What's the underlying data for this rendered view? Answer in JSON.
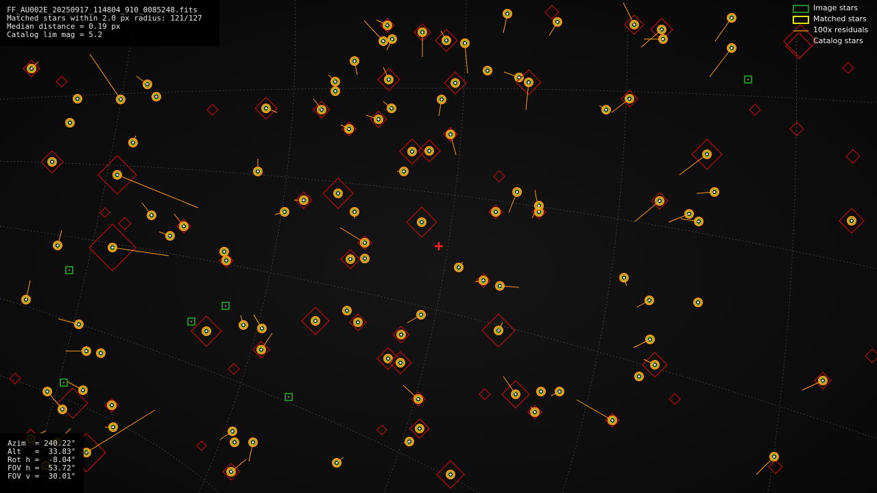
{
  "info_top": {
    "filename": "FF_AU002E_20250917_114804_910_0085248.fits",
    "matched_line": "Matched stars within 2.0 px radius: 121/127",
    "median_line": "Median distance = 0.19 px",
    "limmag_line": "Catalog lim mag = 5.2"
  },
  "info_bottom": {
    "azim": "Azim  = 240.22°",
    "alt": "Alt   =  33.83°",
    "rot": "Rot h =  -8.04°",
    "fovh": "FOV h =  53.72°",
    "fovv": "FOV v =  30.01°"
  },
  "legend": {
    "image_stars": "Image stars",
    "matched_stars": "Matched stars",
    "residuals": "100x residuals",
    "catalog_stars": "Catalog stars"
  },
  "colors": {
    "image_star": "#1f8a1f",
    "matched_star": "#e6e600",
    "residual": "#ff9a1a",
    "catalog_star": "#a01010",
    "center_cross": "#ff2020",
    "grid": "#8a8a8a"
  }
}
